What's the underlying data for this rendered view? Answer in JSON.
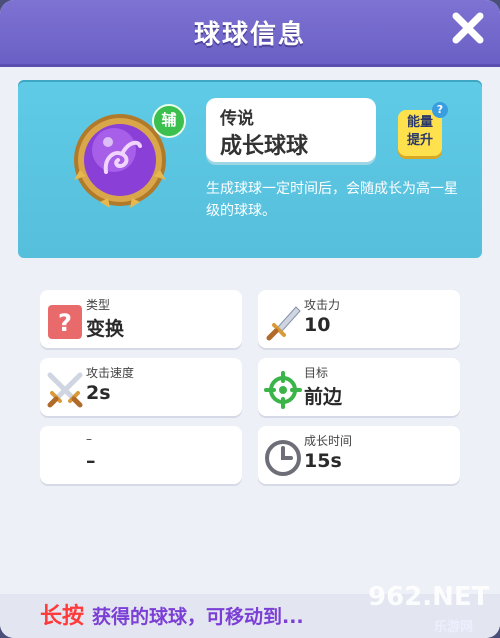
{
  "header": {
    "title": "球球信息"
  },
  "ball": {
    "badge": "辅",
    "rarity": "传说",
    "name": "成长球球",
    "energy_line1": "能量",
    "energy_line2": "提升",
    "help": "?",
    "description": "生成球球一定时间后，会随成长为高一星级的球球。"
  },
  "stats": [
    {
      "label": "类型",
      "value": "变换",
      "icon": "question-mark-icon"
    },
    {
      "label": "攻击力",
      "value": "10",
      "icon": "sword-icon"
    },
    {
      "label": "攻击速度",
      "value": "2s",
      "icon": "crossed-swords-icon"
    },
    {
      "label": "目标",
      "value": "前边",
      "icon": "target-icon"
    },
    {
      "label": "–",
      "value": "–",
      "icon": "none"
    },
    {
      "label": "成长时间",
      "value": "15s",
      "icon": "clock-icon"
    }
  ],
  "hint": {
    "key": "长按",
    "text": "获得的球球，可移动到..."
  },
  "watermark": {
    "text": "962.NET",
    "site": "乐游网"
  },
  "colors": {
    "header": "#6a5fc4",
    "info_card": "#5fcbe6",
    "energy_button": "#ffe14d",
    "hint_key": "#ff3a3a",
    "hint_text": "#7b3fd6"
  }
}
